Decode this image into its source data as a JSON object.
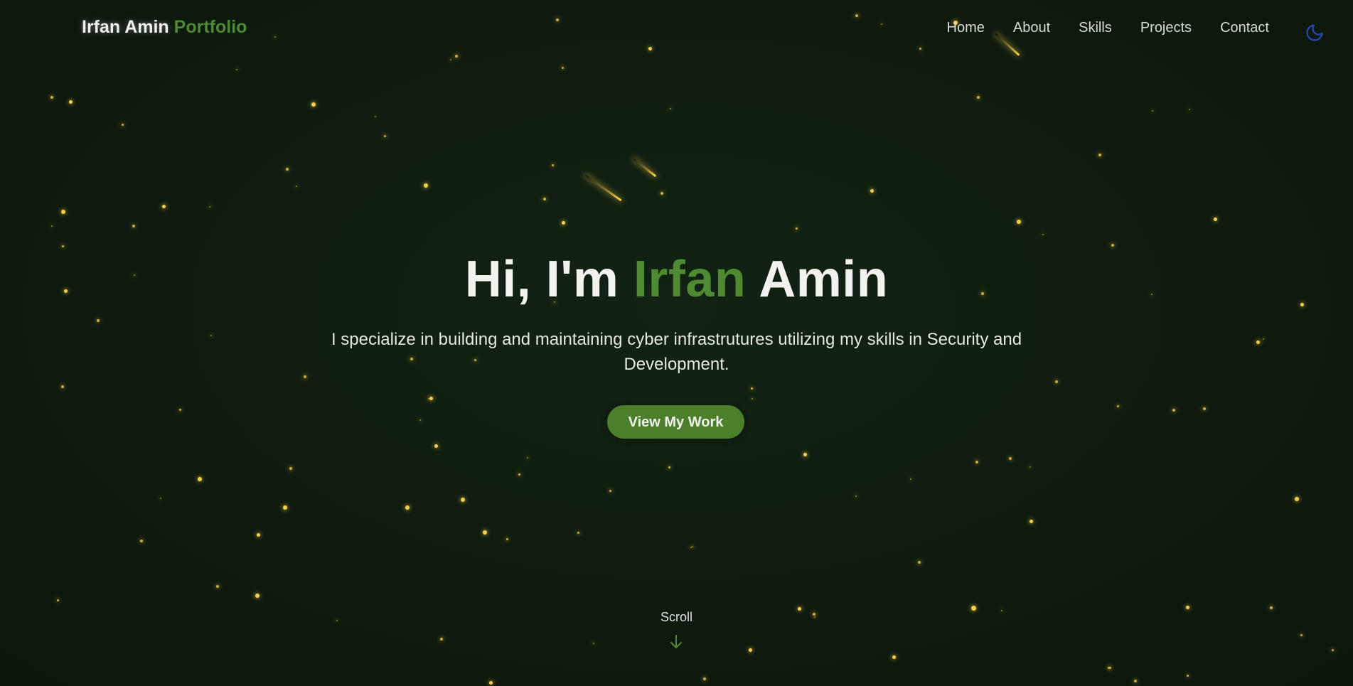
{
  "header": {
    "brand_name": "Irfan Amin",
    "brand_accent": "Portfolio",
    "nav": [
      "Home",
      "About",
      "Skills",
      "Projects",
      "Contact"
    ],
    "theme_toggle_icon": "moon-icon"
  },
  "hero": {
    "title_prefix": "Hi, I'm",
    "title_highlight": "Irfan",
    "title_suffix": "Amin",
    "subtitle": "I specialize in building and maintaining cyber infrastrutures utilizing my skills in Security and Development.",
    "cta_label": "View My Work"
  },
  "scroll": {
    "label": "Scroll",
    "icon": "arrow-down-icon"
  },
  "colors": {
    "background": "#0f1c0f",
    "accent_green": "#4d8a32",
    "star_yellow": "#f5d04a",
    "moon_blue": "#2a45b0"
  }
}
